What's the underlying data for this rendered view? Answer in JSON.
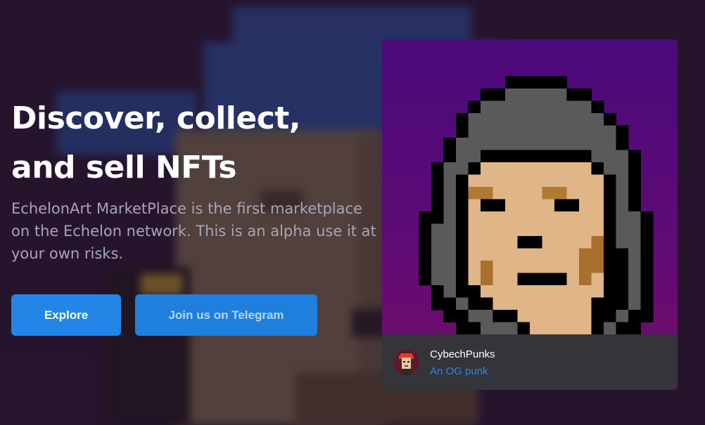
{
  "hero": {
    "title": "Discover, collect, and sell NFTs",
    "description": "EchelonArt MarketPlace is the first marketplace on the Echelon network. This is an alpha use it at your own risks.",
    "explore_label": "Explore",
    "telegram_label": "Join us on Telegram"
  },
  "featured": {
    "collection_name": "CybechPunks",
    "subtitle": "An OG punk",
    "art_icon": "pixel-punk-hooded",
    "avatar_icon": "pixel-punk-avatar"
  },
  "colors": {
    "accent": "#2385e6",
    "link": "#2a86e8",
    "card_bg": "#34353a",
    "art_bg": "#5c0b77",
    "skin": "#e0b587",
    "hood": "#5a5a5a"
  }
}
